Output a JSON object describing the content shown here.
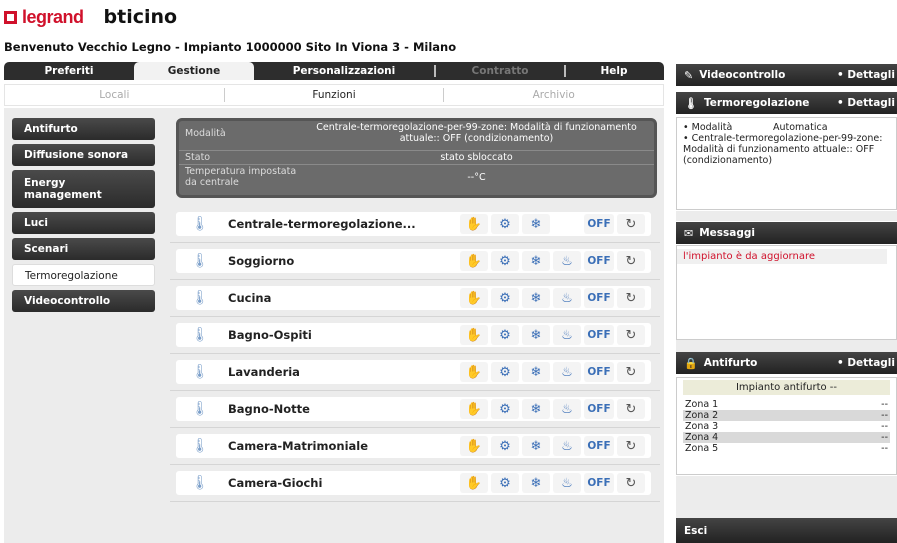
{
  "header": {
    "legrand": "legrand",
    "bticino": "bticino",
    "welcome": "Benvenuto Vecchio Legno - Impianto 1000000 Sito In Viona 3 - Milano"
  },
  "tabs": {
    "preferiti": "Preferiti",
    "gestione": "Gestione",
    "personalizzazioni": "Personalizzazioni",
    "contratto": "Contratto",
    "help": "Help"
  },
  "subtabs": {
    "locali": "Locali",
    "funzioni": "Funzioni",
    "archivio": "Archivio"
  },
  "nav": {
    "antifurto": "Antifurto",
    "diffusione": "Diffusione sonora",
    "energy": "Energy management",
    "luci": "Luci",
    "scenari": "Scenari",
    "termo": "Termoregolazione",
    "video": "Videocontrollo"
  },
  "info": {
    "mod_label": "Modalità",
    "mod_value": "Centrale-termoregolazione-per-99-zone: Modalità di funzionamento attuale:: OFF (condizionamento)",
    "stato_label": "Stato",
    "stato_value": "stato sbloccato",
    "temp_label": "Temperatura impostata da centrale",
    "temp_value": "--°C"
  },
  "zones": [
    {
      "name": "Centrale-termoregolazione...",
      "has_heat": false
    },
    {
      "name": "Soggiorno",
      "has_heat": true
    },
    {
      "name": "Cucina",
      "has_heat": true
    },
    {
      "name": "Bagno-Ospiti",
      "has_heat": true
    },
    {
      "name": "Lavanderia",
      "has_heat": true
    },
    {
      "name": "Bagno-Notte",
      "has_heat": true
    },
    {
      "name": "Camera-Matrimoniale",
      "has_heat": true
    },
    {
      "name": "Camera-Giochi",
      "has_heat": true
    }
  ],
  "zone_buttons": {
    "off": "OFF"
  },
  "right": {
    "video_title": "Videocontrollo",
    "dettagli": "• Dettagli",
    "termo_title": "Termoregolazione",
    "termo_line1_a": "• Modalità",
    "termo_line1_b": "Automatica",
    "termo_line2": "• Centrale-termoregolazione-per-99-zone: Modalità di funzionamento attuale:: OFF (condizionamento)",
    "msg_title": "Messaggi",
    "msg_text": "l'impianto è da aggiornare",
    "anti_title": "Antifurto",
    "anti_header": "Impianto antifurto --",
    "anti_zones": [
      {
        "name": "Zona 1",
        "value": "--"
      },
      {
        "name": "Zona 2",
        "value": "--"
      },
      {
        "name": "Zona 3",
        "value": "--"
      },
      {
        "name": "Zona 4",
        "value": "--"
      },
      {
        "name": "Zona 5",
        "value": "--"
      }
    ],
    "esci": "Esci"
  }
}
